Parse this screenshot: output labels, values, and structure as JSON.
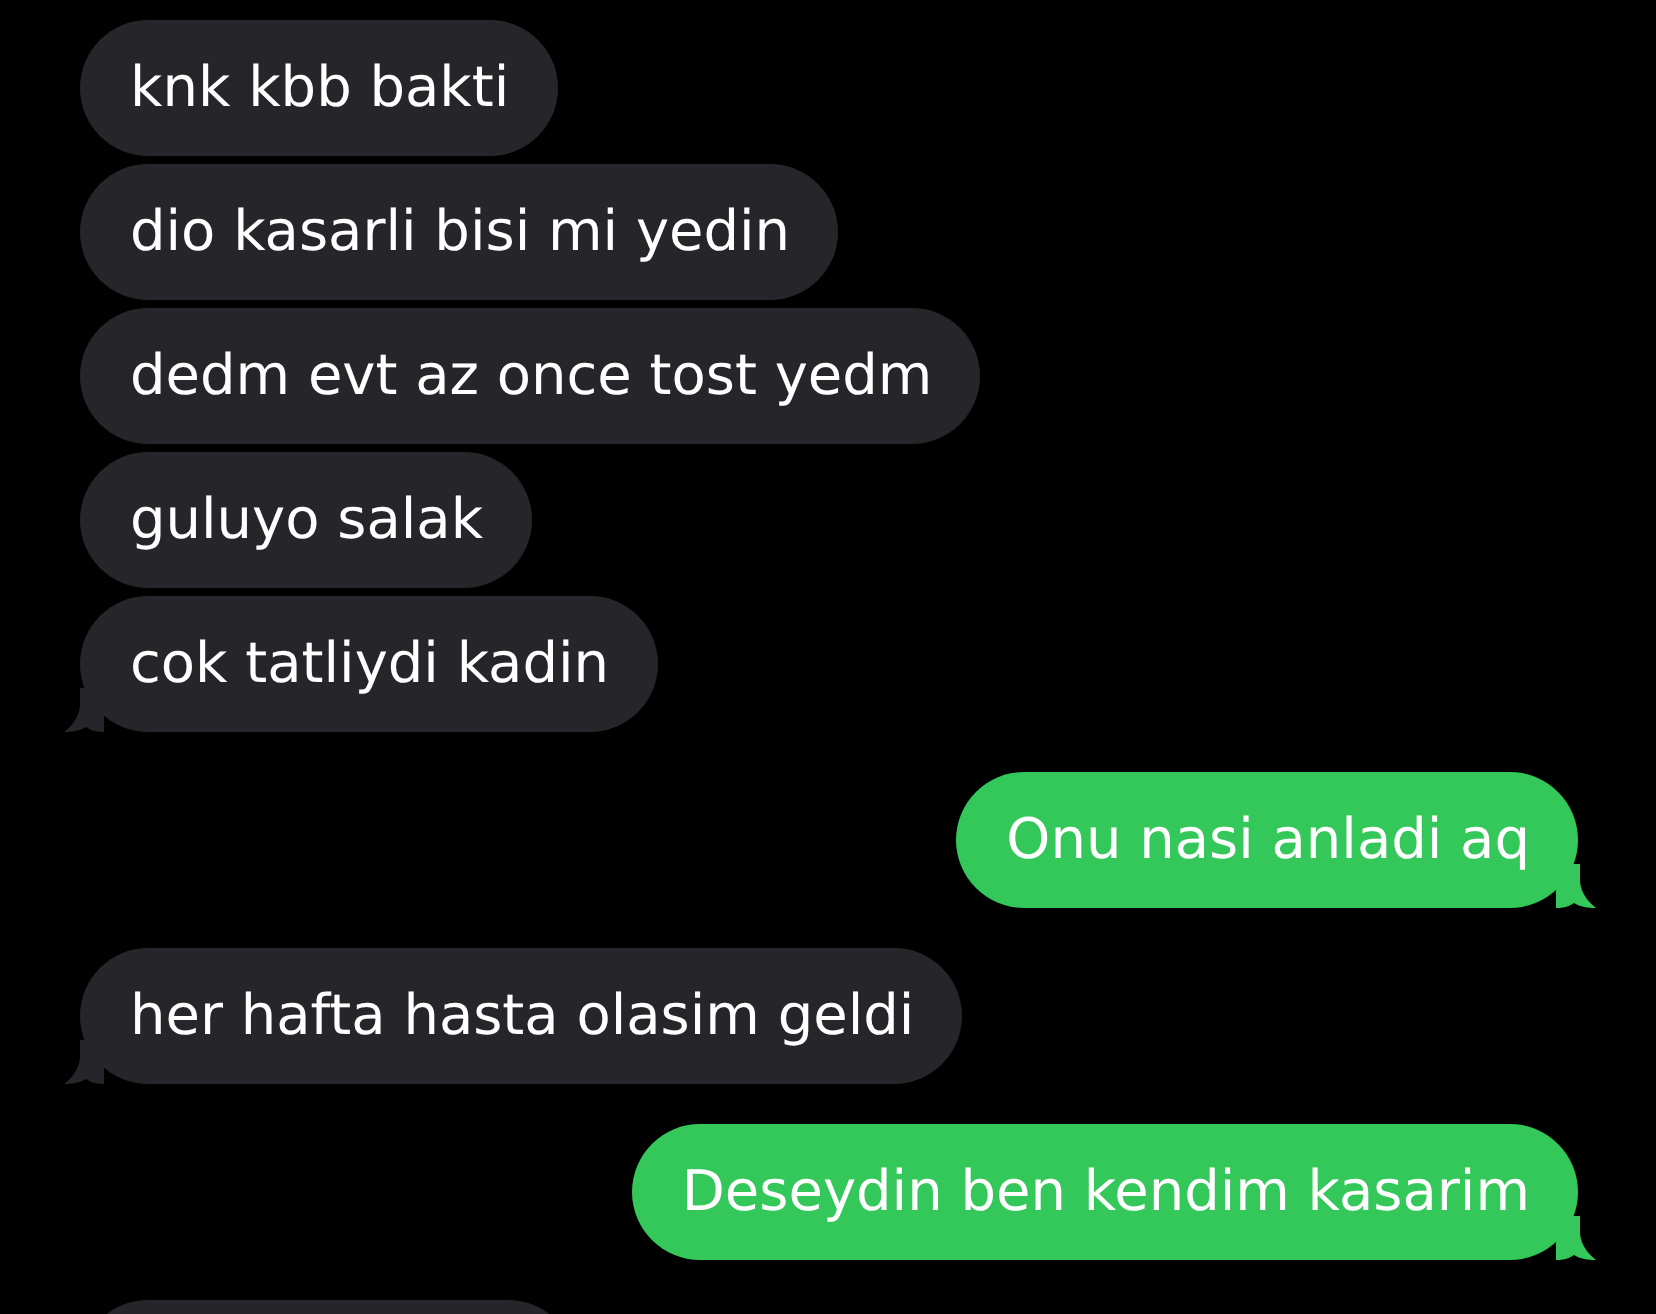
{
  "messages": [
    {
      "kind": "received",
      "text": "knk kbb bakti"
    },
    {
      "kind": "received",
      "text": "dio kasarli bisi mi yedin"
    },
    {
      "kind": "received",
      "text": "dedm evt az once tost yedm"
    },
    {
      "kind": "received",
      "text": "guluyo salak"
    },
    {
      "kind": "received",
      "text": "cok tatliydi kadin"
    },
    {
      "kind": "sent",
      "text": "Onu nasi anladi aq"
    },
    {
      "kind": "received",
      "text": "her hafta hasta olasim geldi"
    },
    {
      "kind": "sent",
      "text": "Deseydin ben kendim kasarim"
    },
    {
      "kind": "received"
    }
  ]
}
